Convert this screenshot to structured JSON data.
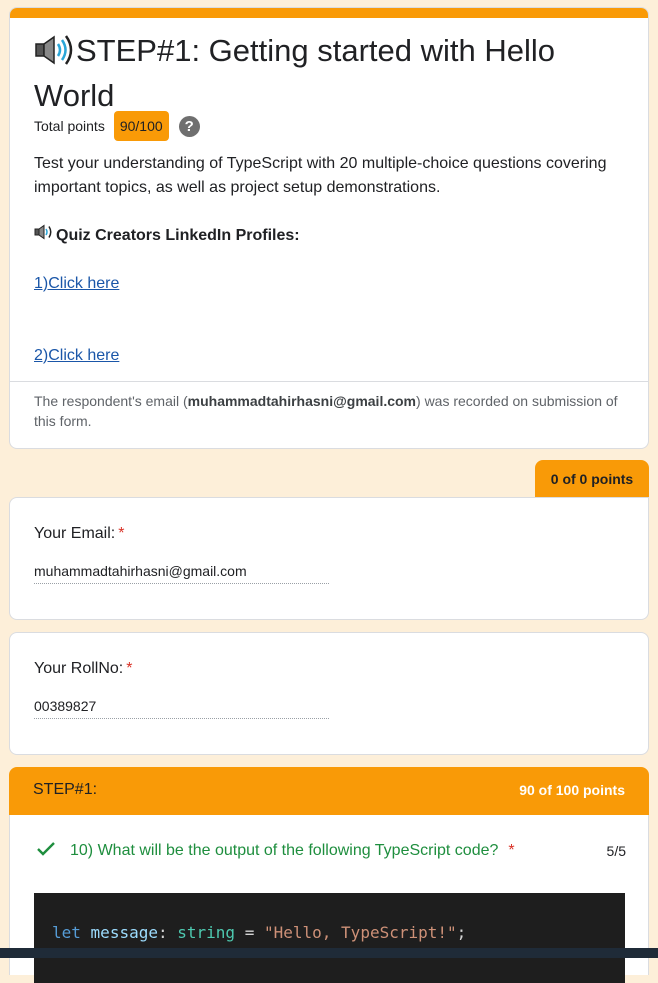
{
  "header": {
    "title": "STEP#1: Getting started with Hello World",
    "total_points_label": "Total points",
    "total_points_value": "90/100",
    "help_symbol": "?",
    "description": "Test your understanding of TypeScript with 20 multiple-choice questions covering important topics, as well as project setup demonstrations.",
    "creators_heading": "Quiz Creators LinkedIn Profiles:",
    "links": [
      "1)Click here",
      "2)Click here"
    ],
    "email_note_prefix": "The respondent's email (",
    "email_note_email": "muhammadtahirhasni@gmail.com",
    "email_note_suffix": ") was recorded on submission of this form."
  },
  "section_points": "0 of 0 points",
  "questions": [
    {
      "label": "Your Email:",
      "required": "*",
      "answer": "muhammadtahirhasni@gmail.com"
    },
    {
      "label": "Your RollNo:",
      "required": "*",
      "answer": "00389827"
    }
  ],
  "step_section": {
    "name": "STEP#1:",
    "score": "90 of 100 points",
    "question": {
      "text": "10) What will be the output of the following TypeScript code?",
      "required": "*",
      "score": "5/5",
      "code": {
        "keyword": "let",
        "variable": "message",
        "colon": ":",
        "type": "string",
        "equals": "=",
        "value": "\"Hello, TypeScript!\"",
        "semicolon": ";"
      }
    }
  },
  "colors": {
    "accent": "#f99a07",
    "background": "#fdefd9",
    "correct": "#1e8e3e",
    "required": "#d93025"
  }
}
